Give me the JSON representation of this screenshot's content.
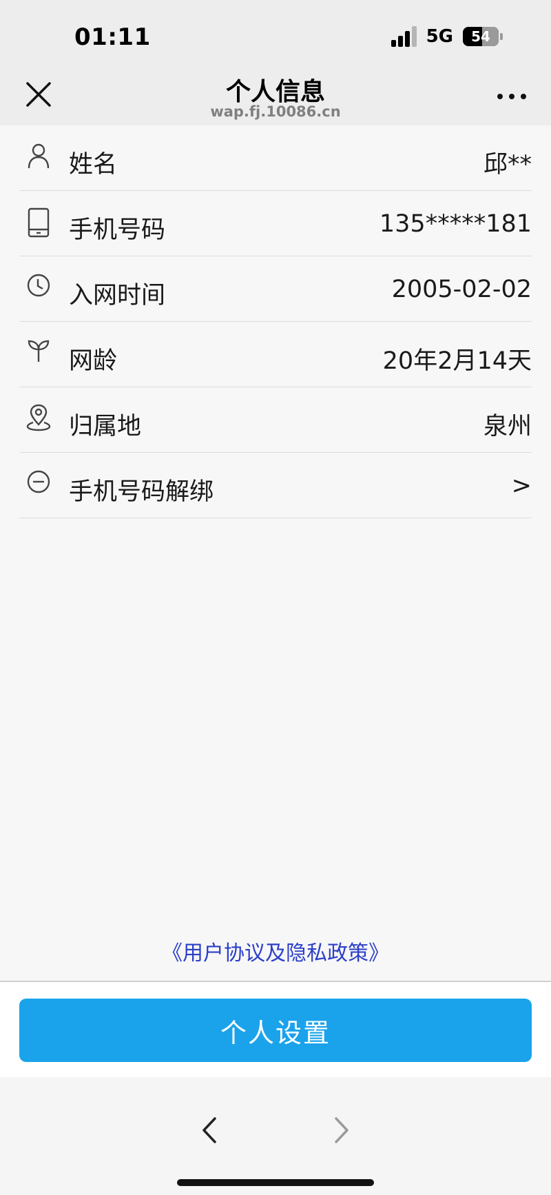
{
  "status_bar": {
    "time": "01:11",
    "network": "5G",
    "battery_level": 54,
    "battery_text": "54",
    "signal_bars": 4,
    "signal_active": 3
  },
  "nav": {
    "title": "个人信息",
    "subtitle": "wap.fj.10086.cn",
    "close_icon": "close-icon",
    "more_icon": "more-icon"
  },
  "info_rows": [
    {
      "icon": "person-icon",
      "label": "姓名",
      "value": "邱**"
    },
    {
      "icon": "phone-icon",
      "label": "手机号码",
      "value": "135*****181"
    },
    {
      "icon": "clock-icon",
      "label": "入网时间",
      "value": "2005-02-02"
    },
    {
      "icon": "sprout-icon",
      "label": "网龄",
      "value": "20年2月14天"
    },
    {
      "icon": "location-icon",
      "label": "归属地",
      "value": "泉州"
    },
    {
      "icon": "minus-circle-icon",
      "label": "手机号码解绑",
      "value": ">"
    }
  ],
  "agreement_link": "《用户协议及隐私政策》",
  "settings_button": "个人设置",
  "colors": {
    "accent": "#1aa3eb",
    "link": "#2b3fc8"
  }
}
